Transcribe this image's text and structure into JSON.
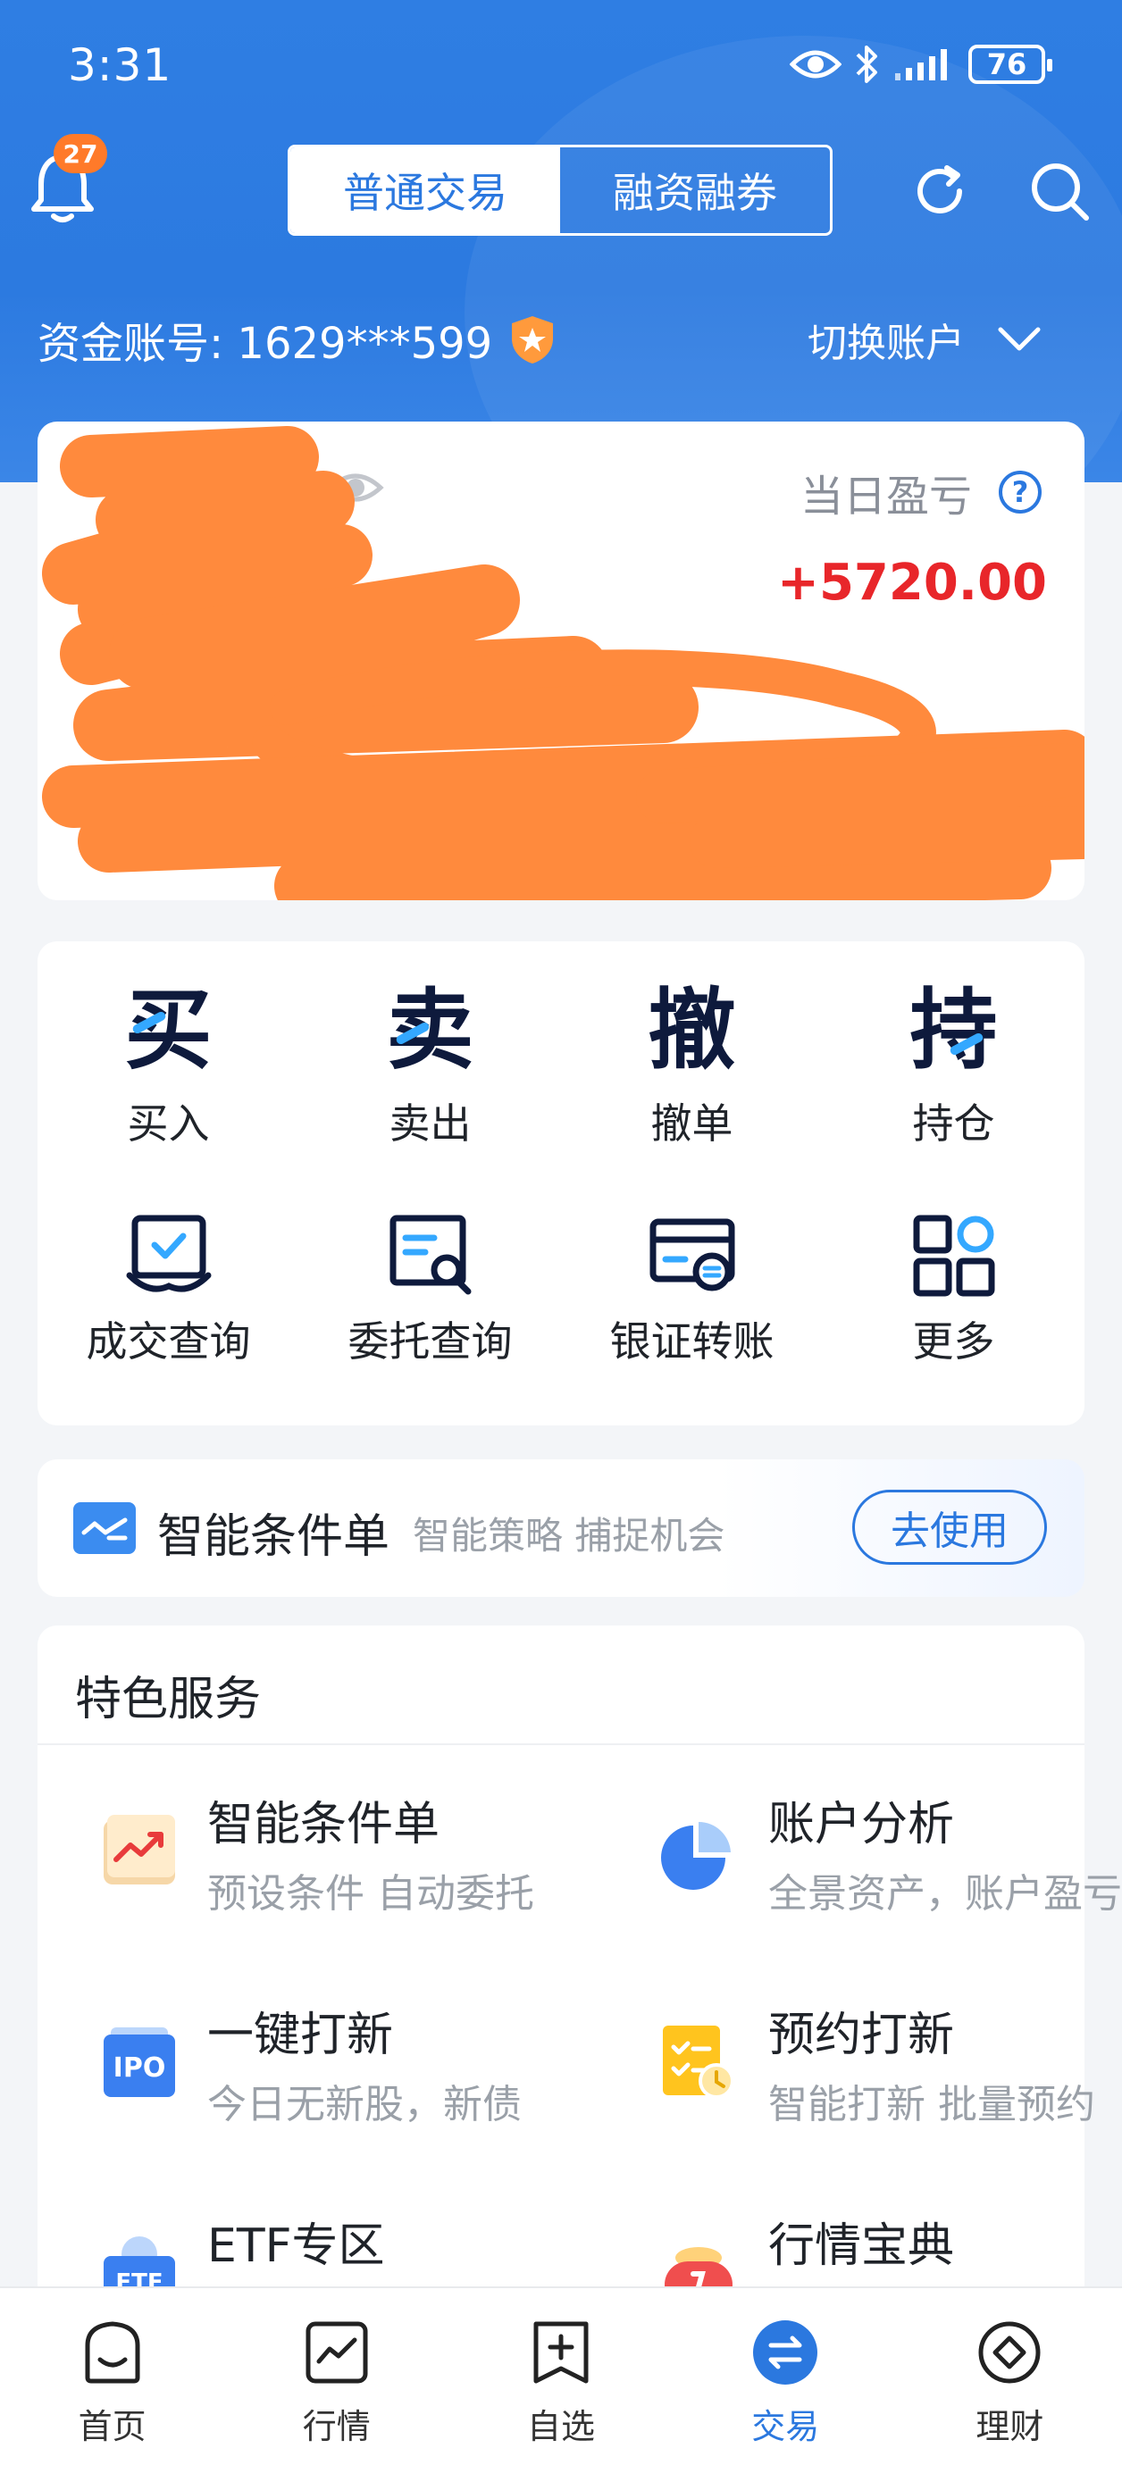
{
  "status_bar": {
    "time": "3:31",
    "battery": "76"
  },
  "header": {
    "notification_count": "27",
    "tabs": [
      {
        "label": "普通交易",
        "active": true
      },
      {
        "label": "融资融券",
        "active": false
      }
    ],
    "account_label": "资金账号: 1629***599",
    "switch_account": "切换账户"
  },
  "asset_card": {
    "daily_pnl_label": "当日盈亏",
    "daily_pnl_value": "+5720.00"
  },
  "trade_actions": [
    {
      "glyph": "买",
      "label": "买入"
    },
    {
      "glyph": "卖",
      "label": "卖出"
    },
    {
      "glyph": "撤",
      "label": "撤单"
    },
    {
      "glyph": "持",
      "label": "持仓"
    },
    {
      "icon": "deal-query-icon",
      "label": "成交查询"
    },
    {
      "icon": "order-query-icon",
      "label": "委托查询"
    },
    {
      "icon": "bank-transfer-icon",
      "label": "银证转账"
    },
    {
      "icon": "more-grid-icon",
      "label": "更多"
    }
  ],
  "smart_banner": {
    "title": "智能条件单",
    "subtitle": "智能策略 捕捉机会",
    "button": "去使用"
  },
  "services": {
    "title": "特色服务",
    "items": [
      {
        "name": "智能条件单",
        "desc": "预设条件 自动委托",
        "icon": "smart-order-icon"
      },
      {
        "name": "账户分析",
        "desc": "全景资产，账户盈亏",
        "icon": "pie-chart-icon"
      },
      {
        "name": "一键打新",
        "desc": "今日无新股，新债",
        "icon": "ipo-icon"
      },
      {
        "name": "预约打新",
        "desc": "智能打新 批量预约",
        "icon": "reserve-ipo-icon"
      },
      {
        "name": "ETF专区",
        "desc": "",
        "icon": "etf-icon"
      },
      {
        "name": "行情宝典",
        "desc": "",
        "icon": "market-guide-icon"
      }
    ]
  },
  "bottom_nav": [
    {
      "label": "首页",
      "icon": "home-icon"
    },
    {
      "label": "行情",
      "icon": "market-icon"
    },
    {
      "label": "自选",
      "icon": "watchlist-icon"
    },
    {
      "label": "交易",
      "icon": "trade-icon",
      "active": true
    },
    {
      "label": "理财",
      "icon": "wealth-icon"
    }
  ],
  "colors": {
    "brand_blue": "#2b78df",
    "profit_red": "#e8262a",
    "badge_orange": "#ff7a29",
    "redaction_orange": "#ff8a3d"
  }
}
